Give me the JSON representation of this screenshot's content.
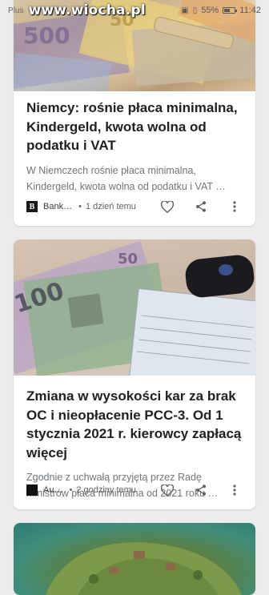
{
  "status_bar": {
    "carrier": "Plus",
    "watermark": "www.wiocha.pl",
    "battery_percent": "55%",
    "time": "11:42"
  },
  "feed": [
    {
      "title": "Niemcy: rośnie płaca minimalna, Kindergeld, kwota wolna od podatku i VAT",
      "snippet": "W Niemczech rośnie płaca minimalna, Kindergeld, kwota wolna od podatku i VAT …",
      "source_logo": "B",
      "source": "Bank…",
      "time_ago": "1 dzień temu",
      "image": "euro-banknotes-photo"
    },
    {
      "title": "Zmiana w wysokości kar za brak OC i nieopłacenie PCC-3. Od 1 stycznia 2021 r. kierowcy zapłacą więcej",
      "snippet": "Zgodnie z uchwałą przyjętą przez Radę Ministrów płaca minimalna od 2021 roku …",
      "source_logo": "",
      "source": "Au…",
      "time_ago": "2 godziny temu",
      "image": "polish-banknotes-and-car-document-photo"
    },
    {
      "image": "island-game-map-photo"
    }
  ],
  "icons": {
    "like": "heart-icon",
    "share": "share-icon",
    "more": "more-vert-icon"
  }
}
